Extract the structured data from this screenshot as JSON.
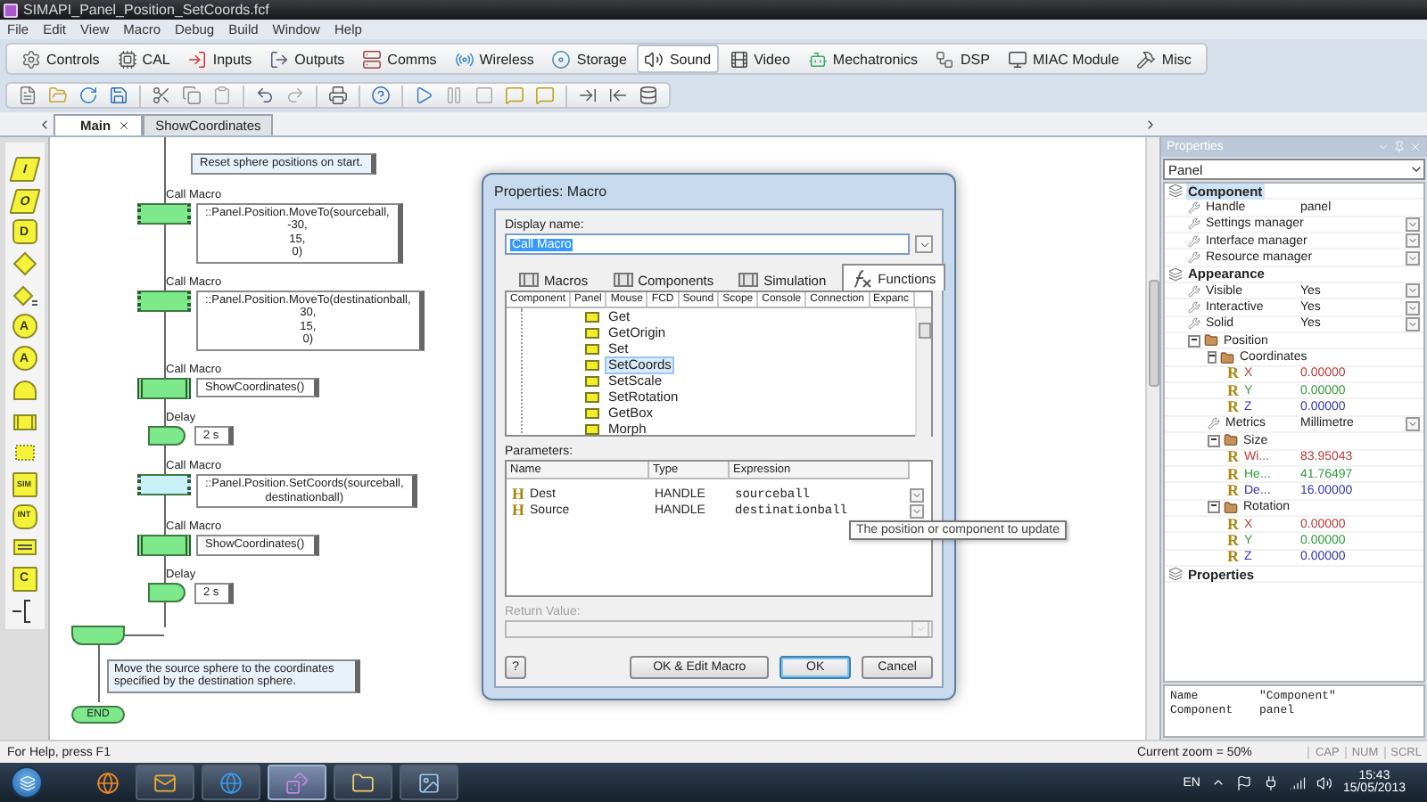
{
  "window": {
    "title": "SIMAPI_Panel_Position_SetCoords.fcf"
  },
  "menu": [
    "File",
    "Edit",
    "View",
    "Macro",
    "Debug",
    "Build",
    "Window",
    "Help"
  ],
  "component_toolbar": [
    {
      "label": "Controls",
      "selected": false
    },
    {
      "label": "CAL",
      "selected": false
    },
    {
      "label": "Inputs",
      "selected": false
    },
    {
      "label": "Outputs",
      "selected": false
    },
    {
      "label": "Comms",
      "selected": false
    },
    {
      "label": "Wireless",
      "selected": false
    },
    {
      "label": "Storage",
      "selected": false
    },
    {
      "label": "Sound",
      "selected": true
    },
    {
      "label": "Video",
      "selected": false
    },
    {
      "label": "Mechatronics",
      "selected": false
    },
    {
      "label": "DSP",
      "selected": false
    },
    {
      "label": "MIAC Module",
      "selected": false
    },
    {
      "label": "Misc",
      "selected": false
    }
  ],
  "palette": [
    {
      "kind": "parallelogram",
      "label": "I"
    },
    {
      "kind": "parallelogram",
      "label": "O"
    },
    {
      "kind": "rounded",
      "label": "D"
    },
    {
      "kind": "diamond"
    },
    {
      "kind": "diamond_menu"
    },
    {
      "kind": "circle",
      "label": "A"
    },
    {
      "kind": "circle",
      "label": "A"
    },
    {
      "kind": "half"
    },
    {
      "kind": "bars"
    },
    {
      "kind": "dotted"
    },
    {
      "kind": "label_rect",
      "label": "SIM"
    },
    {
      "kind": "hexagon",
      "label": "INT"
    },
    {
      "kind": "lines"
    },
    {
      "kind": "label_rect",
      "label": "C"
    },
    {
      "kind": "bracket"
    }
  ],
  "document_tabs": [
    {
      "label": "Main",
      "selected": true,
      "closable": true
    },
    {
      "label": "ShowCoordinates",
      "selected": false,
      "closable": false
    }
  ],
  "flowchart": {
    "steps": [
      {
        "kind": "comment",
        "selected": false,
        "lines": [
          "Reset sphere positions on start."
        ]
      },
      {
        "kind": "call",
        "caption": "Call Macro",
        "subroutine": false,
        "selected": false,
        "lines": [
          "::Panel.Position.MoveTo(sourceball,",
          "-30,",
          "15,",
          "0)"
        ]
      },
      {
        "kind": "call",
        "caption": "Call Macro",
        "subroutine": false,
        "selected": false,
        "lines": [
          "::Panel.Position.MoveTo(destinationball,",
          "30,",
          "15,",
          "0)"
        ]
      },
      {
        "kind": "call",
        "caption": "Call Macro",
        "subroutine": true,
        "selected": false,
        "lines": [
          "ShowCoordinates()"
        ]
      },
      {
        "kind": "delay",
        "caption": "Delay",
        "selected": false,
        "lines": [
          "2 s"
        ]
      },
      {
        "kind": "call",
        "caption": "Call Macro",
        "subroutine": false,
        "selected": true,
        "lines": [
          "::Panel.Position.SetCoords(sourceball,",
          "destinationball)"
        ]
      },
      {
        "kind": "call",
        "caption": "Call Macro",
        "subroutine": true,
        "selected": false,
        "lines": [
          "ShowCoordinates()"
        ]
      },
      {
        "kind": "delay",
        "caption": "Delay",
        "selected": false,
        "lines": [
          "2 s"
        ]
      }
    ],
    "footer_comment": "Move the source sphere to the coordinates specified by the destination sphere.",
    "end_label": "END"
  },
  "dialog": {
    "title": "Properties: Macro",
    "display_name_label": "Display name:",
    "display_name": "Call Macro",
    "tabs": [
      {
        "label": "Macros",
        "selected": false
      },
      {
        "label": "Components",
        "selected": false
      },
      {
        "label": "Simulation",
        "selected": false
      },
      {
        "label": "Functions",
        "selected": true
      }
    ],
    "tree_columns": [
      "Component",
      "Panel",
      "Mouse",
      "FCD",
      "Sound",
      "Scope",
      "Console",
      "Connection",
      "Expanc"
    ],
    "functions": [
      {
        "label": "Get",
        "selected": false
      },
      {
        "label": "GetOrigin",
        "selected": false
      },
      {
        "label": "Set",
        "selected": false
      },
      {
        "label": "SetCoords",
        "selected": true
      },
      {
        "label": "SetScale",
        "selected": false
      },
      {
        "label": "SetRotation",
        "selected": false
      },
      {
        "label": "GetBox",
        "selected": false
      },
      {
        "label": "Morph",
        "selected": false
      }
    ],
    "parameters_label": "Parameters:",
    "parameter_columns": [
      "Name",
      "Type",
      "Expression"
    ],
    "parameters": [
      {
        "badge": "H",
        "name": "Dest",
        "type": "HANDLE",
        "expression": "sourceball"
      },
      {
        "badge": "H",
        "name": "Source",
        "type": "HANDLE",
        "expression": "destinationball"
      }
    ],
    "return_value": {
      "label": "Return Value:",
      "disabled": true
    },
    "buttons": [
      {
        "label": "?",
        "default": false
      },
      {
        "label": "OK & Edit Macro",
        "default": false
      },
      {
        "label": "OK",
        "default": true
      },
      {
        "label": "Cancel",
        "default": false
      }
    ]
  },
  "tooltip": "The position or component to update",
  "properties_panel": {
    "title": "Properties",
    "selector": "Panel",
    "tree": [
      {
        "kind": "category",
        "label": "Component",
        "selected": true,
        "children": [
          {
            "kind": "property",
            "label": "Handle",
            "value": "panel",
            "dropdown": false
          },
          {
            "kind": "property",
            "label": "Settings manager",
            "dropdown": true
          },
          {
            "kind": "property",
            "label": "Interface manager",
            "dropdown": true
          },
          {
            "kind": "property",
            "label": "Resource manager",
            "dropdown": true
          }
        ]
      },
      {
        "kind": "category",
        "label": "Appearance",
        "selected": false,
        "children": [
          {
            "kind": "property",
            "label": "Visible",
            "value": "Yes",
            "dropdown": true
          },
          {
            "kind": "property",
            "label": "Interactive",
            "value": "Yes",
            "dropdown": true
          },
          {
            "kind": "property",
            "label": "Solid",
            "value": "Yes",
            "dropdown": true
          },
          {
            "kind": "folder",
            "label": "Position",
            "expanded": true,
            "children": [
              {
                "kind": "folder",
                "label": "Coordinates",
                "expanded": true,
                "children": [
                  {
                    "kind": "real",
                    "badge": "R",
                    "label": "X",
                    "value": "0.00000",
                    "color": "#b83a3a"
                  },
                  {
                    "kind": "real",
                    "badge": "R",
                    "label": "Y",
                    "value": "0.00000",
                    "color": "#2f9a3c"
                  },
                  {
                    "kind": "real",
                    "badge": "R",
                    "label": "Z",
                    "value": "0.00000",
                    "color": "#3535a8"
                  }
                ]
              },
              {
                "kind": "property",
                "label": "Metrics",
                "value": "Millimetre",
                "dropdown": true
              },
              {
                "kind": "folder",
                "label": "Size",
                "expanded": true,
                "children": [
                  {
                    "kind": "real",
                    "badge": "R",
                    "label": "Wi...",
                    "value": "83.95043",
                    "color": "#b83a3a"
                  },
                  {
                    "kind": "real",
                    "badge": "R",
                    "label": "He...",
                    "value": "41.76497",
                    "color": "#2f9a3c"
                  },
                  {
                    "kind": "real",
                    "badge": "R",
                    "label": "De...",
                    "value": "16.00000",
                    "color": "#3535a8"
                  }
                ]
              },
              {
                "kind": "folder",
                "label": "Rotation",
                "expanded": true,
                "children": [
                  {
                    "kind": "real",
                    "badge": "R",
                    "label": "X",
                    "value": "0.00000",
                    "color": "#b83a3a"
                  },
                  {
                    "kind": "real",
                    "badge": "R",
                    "label": "Y",
                    "value": "0.00000",
                    "color": "#2f9a3c"
                  },
                  {
                    "kind": "real",
                    "badge": "R",
                    "label": "Z",
                    "value": "0.00000",
                    "color": "#3535a8"
                  }
                ]
              }
            ]
          }
        ]
      },
      {
        "kind": "category",
        "label": "Properties",
        "selected": false
      }
    ],
    "info": [
      {
        "key": "Name",
        "value": "\"Component\""
      },
      {
        "key": "Component",
        "value": "panel"
      }
    ]
  },
  "status_bar": {
    "help": "For Help, press F1",
    "zoom": "Current zoom = 50%",
    "indicators": [
      "CAP",
      "NUM",
      "SCRL"
    ]
  },
  "taskbar": {
    "buttons": [
      {
        "kind": "browser",
        "selected": false
      },
      {
        "kind": "mail",
        "selected": false
      },
      {
        "kind": "web",
        "selected": false
      },
      {
        "kind": "app",
        "selected": true
      },
      {
        "kind": "folder",
        "selected": false
      },
      {
        "kind": "tool",
        "selected": false
      }
    ],
    "language": "EN",
    "time": "15:43",
    "date": "15/05/2013"
  }
}
